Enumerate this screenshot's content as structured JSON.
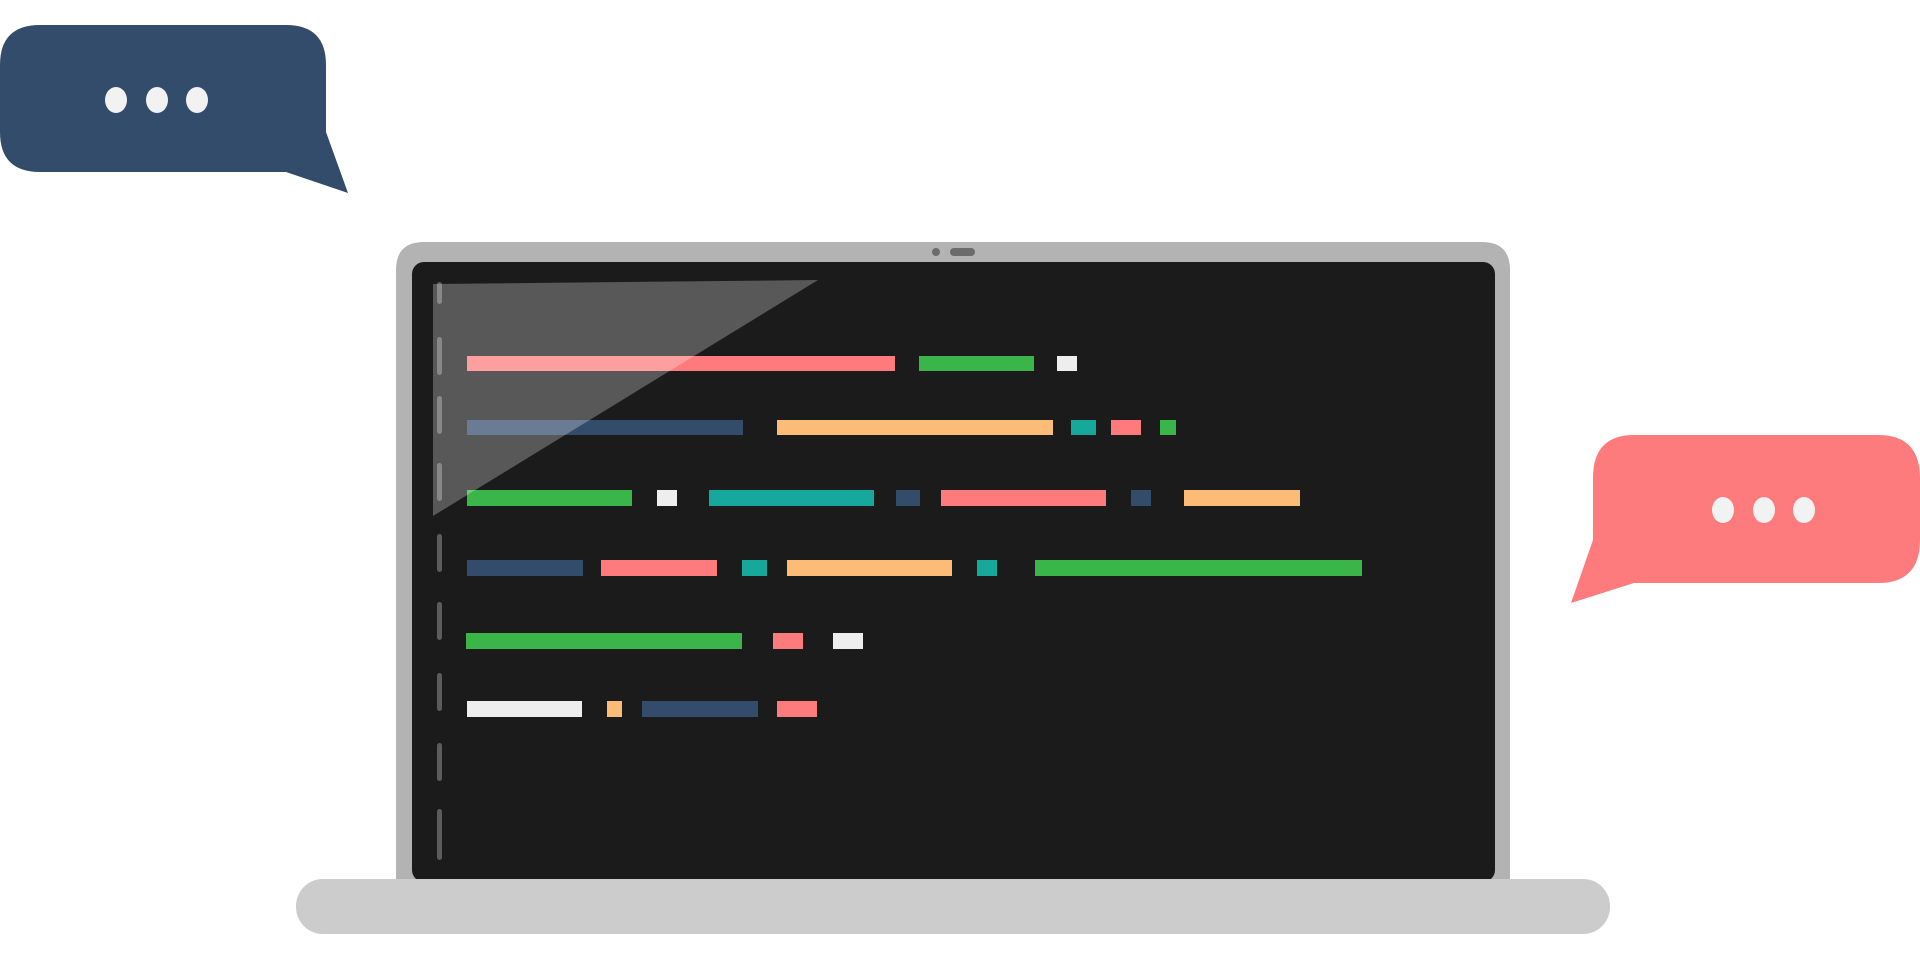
{
  "illustration": {
    "colors": {
      "background": "#ffffff",
      "laptop_frame": "#b3b3b3",
      "laptop_base": "#cccccc",
      "screen": "#1b1b1b",
      "gutter_marks": "#5c5c5c",
      "glare": "#ffffff",
      "camera": "#6b6b6b",
      "bubble_left": "#344c6b",
      "bubble_right": "#fd7b7c",
      "bubble_dots": "#f2f2f2"
    },
    "code_palette": {
      "pink": "#fd7b7c",
      "green": "#3ab54a",
      "white": "#eeeeee",
      "navy": "#344c6b",
      "peach": "#fdbb78",
      "teal": "#16a89a"
    },
    "code_lines": [
      [
        "pink",
        "green",
        "white"
      ],
      [
        "navy",
        "peach",
        "teal",
        "pink",
        "green"
      ],
      [
        "green",
        "white",
        "teal",
        "navy",
        "pink",
        "navy",
        "peach"
      ],
      [
        "navy",
        "pink",
        "teal",
        "peach",
        "teal",
        "green"
      ],
      [
        "green",
        "pink",
        "white"
      ],
      [
        "white",
        "peach",
        "navy",
        "pink"
      ]
    ],
    "bubbles": [
      {
        "side": "left",
        "color_key": "bubble_left",
        "dots": 3,
        "tail": "bottom-right"
      },
      {
        "side": "right",
        "color_key": "bubble_right",
        "dots": 3,
        "tail": "bottom-left"
      }
    ]
  }
}
